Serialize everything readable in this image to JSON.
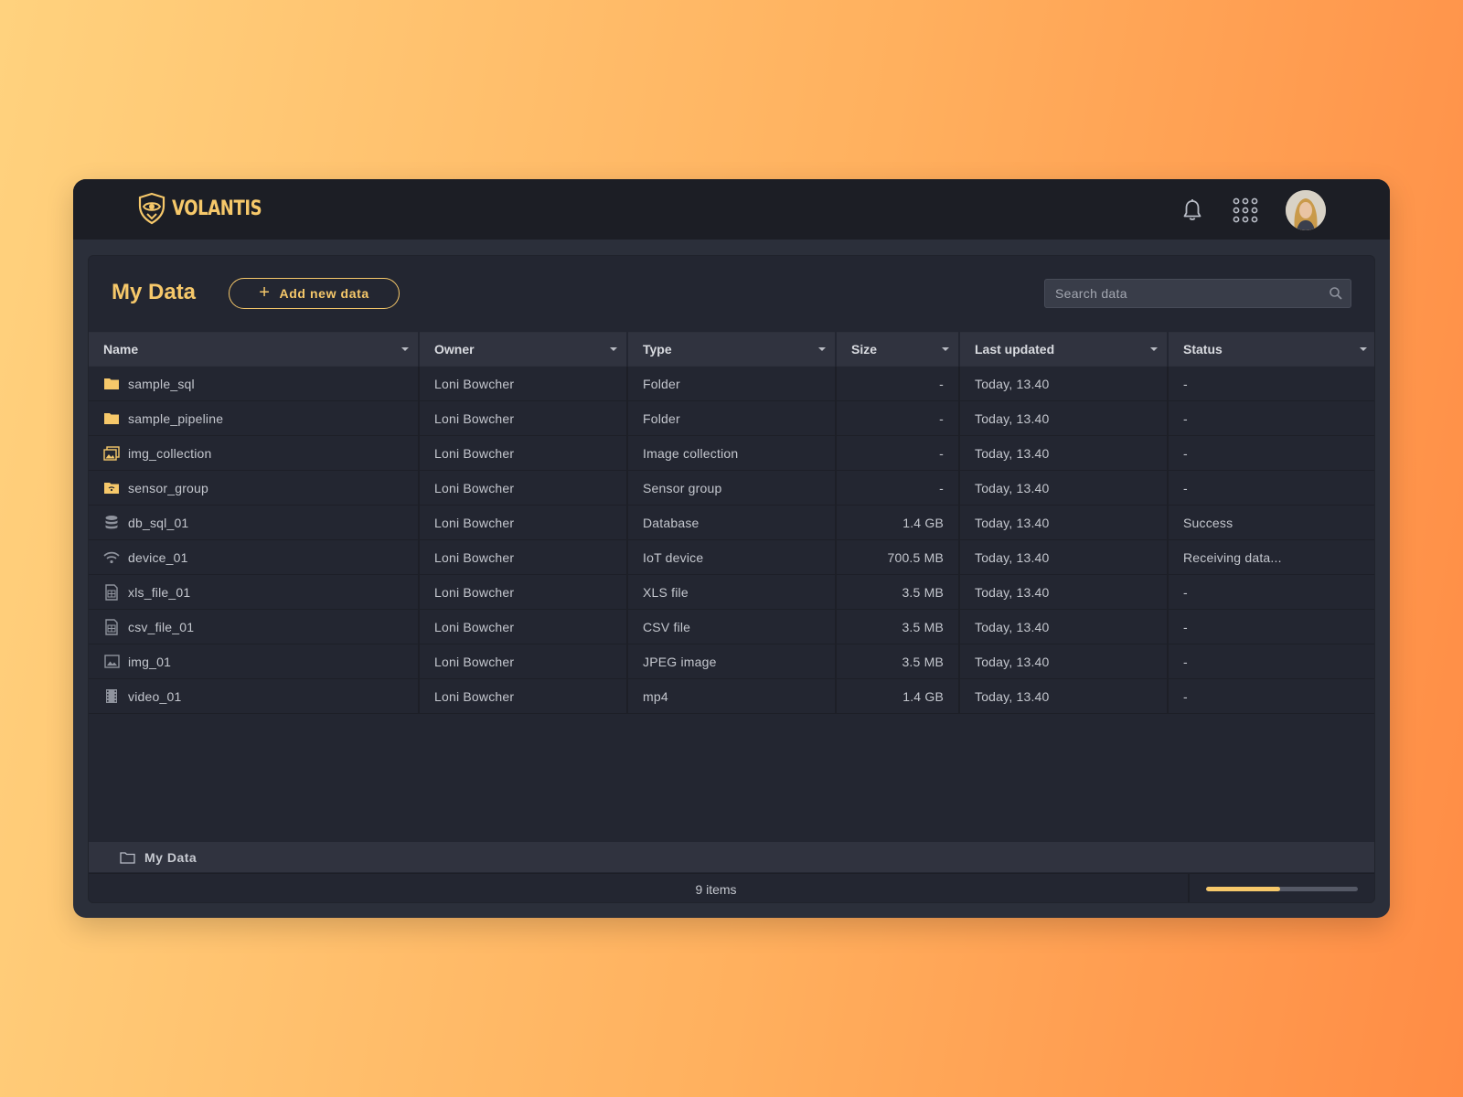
{
  "app": {
    "brand": "VOLANTIS"
  },
  "header": {
    "icons": [
      "bell-icon",
      "apps-grid-icon"
    ],
    "avatar": "user-avatar"
  },
  "page": {
    "title": "My Data",
    "add_button_label": "Add new data",
    "search_placeholder": "Search data"
  },
  "table": {
    "columns": [
      "Name",
      "Owner",
      "Type",
      "Size",
      "Last updated",
      "Status"
    ],
    "rows": [
      {
        "icon": "folder-icon",
        "name": "sample_sql",
        "owner": "Loni Bowcher",
        "type": "Folder",
        "size": "-",
        "updated": "Today, 13.40",
        "status": "-"
      },
      {
        "icon": "folder-icon",
        "name": "sample_pipeline",
        "owner": "Loni Bowcher",
        "type": "Folder",
        "size": "-",
        "updated": "Today, 13.40",
        "status": "-"
      },
      {
        "icon": "image-collection-icon",
        "name": "img_collection",
        "owner": "Loni Bowcher",
        "type": "Image collection",
        "size": "-",
        "updated": "Today, 13.40",
        "status": "-"
      },
      {
        "icon": "sensor-folder-icon",
        "name": "sensor_group",
        "owner": "Loni Bowcher",
        "type": "Sensor group",
        "size": "-",
        "updated": "Today, 13.40",
        "status": "-"
      },
      {
        "icon": "database-icon",
        "name": "db_sql_01",
        "owner": "Loni Bowcher",
        "type": "Database",
        "size": "1.4 GB",
        "updated": "Today, 13.40",
        "status": "Success"
      },
      {
        "icon": "wifi-icon",
        "name": "device_01",
        "owner": "Loni Bowcher",
        "type": "IoT device",
        "size": "700.5 MB",
        "updated": "Today, 13.40",
        "status": "Receiving data..."
      },
      {
        "icon": "spreadsheet-file-icon",
        "name": "xls_file_01",
        "owner": "Loni Bowcher",
        "type": "XLS file",
        "size": "3.5 MB",
        "updated": "Today, 13.40",
        "status": "-"
      },
      {
        "icon": "spreadsheet-file-icon",
        "name": "csv_file_01",
        "owner": "Loni Bowcher",
        "type": "CSV file",
        "size": "3.5 MB",
        "updated": "Today, 13.40",
        "status": "-"
      },
      {
        "icon": "image-icon",
        "name": "img_01",
        "owner": "Loni Bowcher",
        "type": "JPEG image",
        "size": "3.5 MB",
        "updated": "Today, 13.40",
        "status": "-"
      },
      {
        "icon": "film-icon",
        "name": "video_01",
        "owner": "Loni Bowcher",
        "type": "mp4",
        "size": "1.4 GB",
        "updated": "Today, 13.40",
        "status": "-"
      }
    ]
  },
  "breadcrumb": {
    "icon": "folder-outline-icon",
    "label": "My Data"
  },
  "footer": {
    "items_count": "9 items",
    "progress_fraction": 0.49
  },
  "colors": {
    "accent": "#f6c86a",
    "topbar": "#1c1e25",
    "panel": "#232631",
    "header_row": "#30333f",
    "text": "#c4c7ce"
  }
}
